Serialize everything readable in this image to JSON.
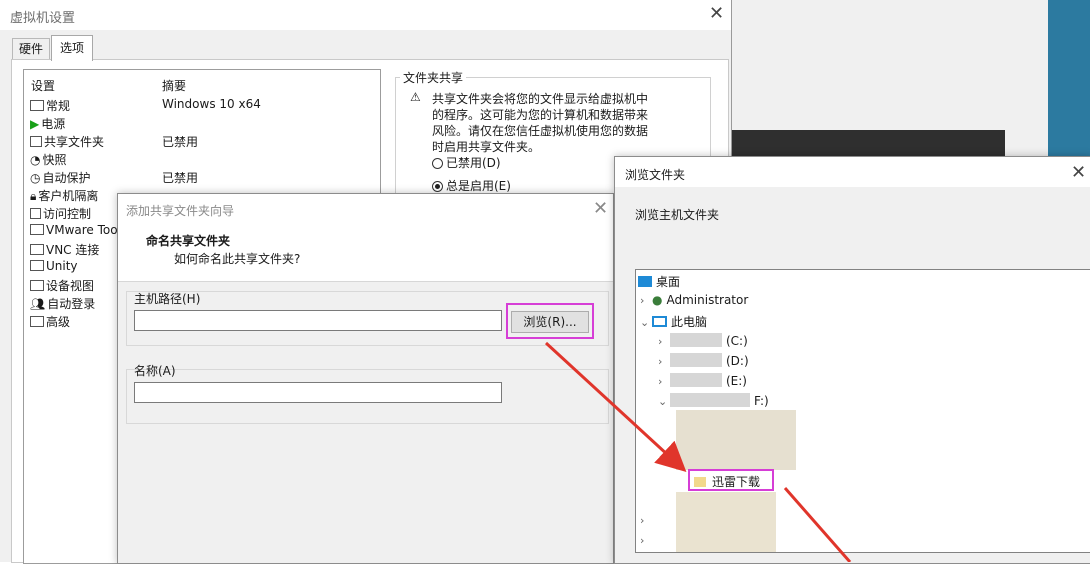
{
  "main_dialog": {
    "title": "虚拟机设置",
    "tabs": [
      "硬件",
      "选项"
    ],
    "list_headers": {
      "setting": "设置",
      "summary": "摘要"
    },
    "settings": [
      {
        "label": "常规",
        "summary": "Windows 10 x64",
        "icon": "general-icon"
      },
      {
        "label": "电源",
        "summary": "",
        "icon": "power-icon"
      },
      {
        "label": "共享文件夹",
        "summary": "已禁用",
        "icon": "shared-folder-icon"
      },
      {
        "label": "快照",
        "summary": "",
        "icon": "snapshot-icon"
      },
      {
        "label": "自动保护",
        "summary": "已禁用",
        "icon": "autoprotect-icon"
      },
      {
        "label": "客户机隔离",
        "summary": "",
        "icon": "lock-icon"
      },
      {
        "label": "访问控制",
        "summary": "",
        "icon": "access-icon"
      },
      {
        "label": "VMware Too",
        "summary": "",
        "icon": "vmware-icon"
      },
      {
        "label": "VNC 连接",
        "summary": "",
        "icon": "vnc-icon"
      },
      {
        "label": "Unity",
        "summary": "",
        "icon": "unity-icon"
      },
      {
        "label": "设备视图",
        "summary": "",
        "icon": "device-view-icon"
      },
      {
        "label": "自动登录",
        "summary": "",
        "icon": "autologin-icon"
      },
      {
        "label": "高级",
        "summary": "",
        "icon": "advanced-icon"
      }
    ],
    "shared_folders": {
      "group_title": "文件夹共享",
      "warning_lines": [
        "共享文件夹会将您的文件显示给虚拟机中",
        "的程序。这可能为您的计算机和数据带来",
        "风险。请仅在您信任虚拟机使用您的数据",
        "时启用共享文件夹。"
      ],
      "opt_disabled": "已禁用(D)",
      "opt_always": "总是启用(E)"
    }
  },
  "wizard": {
    "title": "添加共享文件夹向导",
    "heading": "命名共享文件夹",
    "subheading": "如何命名此共享文件夹?",
    "host_path_label": "主机路径(H)",
    "host_path_value": "",
    "browse_label": "浏览(R)...",
    "name_label": "名称(A)",
    "name_value": ""
  },
  "browse_dialog": {
    "title": "浏览文件夹",
    "description": "浏览主机文件夹",
    "tree": {
      "desktop": "桌面",
      "user": "Administrator",
      "this_pc": "此电脑",
      "drive_c": "(C:)",
      "drive_d": "(D:)",
      "drive_e": "(E:)",
      "drive_f": "F:)",
      "selected_folder": "迅雷下载"
    }
  },
  "colors": {
    "highlight": "#d63ed6",
    "arrow": "#e0352b",
    "accent": "#2c7aa0"
  }
}
